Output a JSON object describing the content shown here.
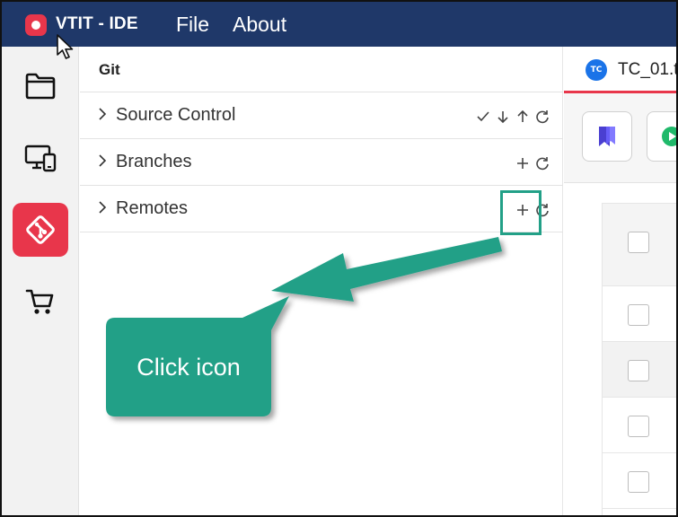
{
  "titlebar": {
    "app_name": "VTIT - IDE",
    "menu": [
      "File",
      "About"
    ],
    "logo_color": "#e8364b",
    "bg_color": "#1f3869"
  },
  "activitybar": {
    "items": [
      {
        "icon": "folder-icon",
        "active": false
      },
      {
        "icon": "devices-icon",
        "active": false
      },
      {
        "icon": "git-icon",
        "active": true
      },
      {
        "icon": "cart-icon",
        "active": false
      }
    ],
    "active_color": "#e8364b"
  },
  "sidepanel": {
    "title": "Git",
    "sections": [
      {
        "label": "Source Control",
        "actions": [
          "check-icon",
          "arrow-down-icon",
          "arrow-up-icon",
          "refresh-icon"
        ]
      },
      {
        "label": "Branches",
        "actions": [
          "plus-icon",
          "refresh-icon"
        ]
      },
      {
        "label": "Remotes",
        "actions": [
          "plus-icon",
          "refresh-icon"
        ]
      }
    ]
  },
  "editor": {
    "tab": {
      "badge": "TC",
      "label": "TC_01.t"
    },
    "toolbar": [
      "bookmark-icon",
      "play-icon"
    ],
    "accent_color": "#e8364b"
  },
  "annotation": {
    "text": "Click icon",
    "color": "#22a087"
  }
}
